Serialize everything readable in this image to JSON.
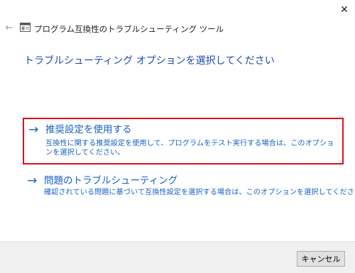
{
  "window": {
    "close_glyph": "✕",
    "back_glyph": "←",
    "title": "プログラム互換性のトラブルシューティング ツール"
  },
  "heading": "トラブルシューティング オプションを選択してください",
  "options": [
    {
      "arrow": "→",
      "title": "推奨設定を使用する",
      "description": "互換性に関する推奨設定を使用して、プログラムをテスト実行する場合は、このオプションを選択してください。",
      "selected": true
    },
    {
      "arrow": "→",
      "title": "問題のトラブルシューティング",
      "description": "確認されている問題に基づいて互換性設定を選択する場合は、このオプションを選択してください。",
      "selected": false
    }
  ],
  "footer": {
    "cancel_label": "キャンセル"
  },
  "colors": {
    "heading": "#1e4ba8",
    "link": "#1762c2",
    "selection_border": "#e20f1b",
    "footer_bg": "#f0f0f0"
  },
  "icons": {
    "close": "close-icon",
    "back": "back-arrow-icon",
    "app": "program-window-icon",
    "option_arrow": "right-arrow-icon"
  }
}
